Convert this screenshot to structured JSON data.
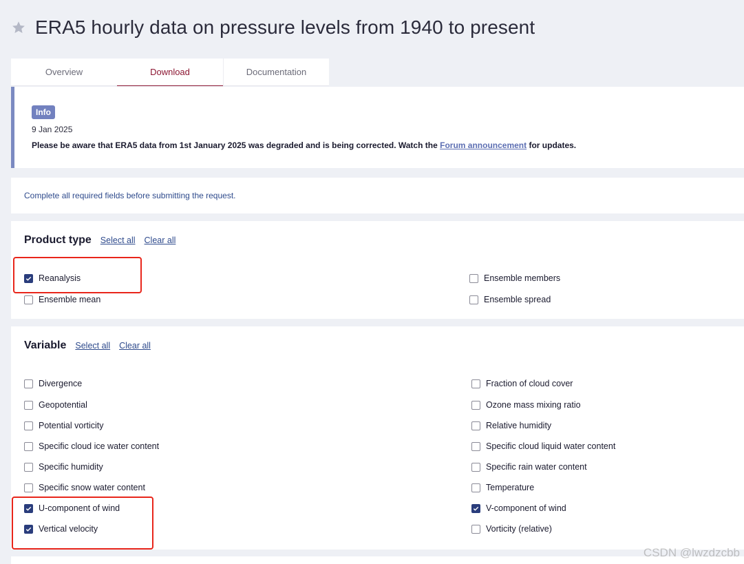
{
  "page": {
    "title": "ERA5 hourly data on pressure levels from 1940 to present",
    "tabs": [
      {
        "label": "Overview",
        "active": false
      },
      {
        "label": "Download",
        "active": true
      },
      {
        "label": "Documentation",
        "active": false
      }
    ]
  },
  "info": {
    "badge": "Info",
    "date": "9 Jan 2025",
    "message": "Please be aware that ERA5 data from 1st January 2025 was degraded and is being corrected. Watch the ",
    "link": "Forum announcement",
    "message_suffix": " for updates."
  },
  "notice": "Complete all required fields before submitting the request.",
  "product_type": {
    "title": "Product type",
    "select_all": "Select all",
    "clear_all": "Clear all",
    "options": [
      {
        "label": "Reanalysis",
        "checked": true
      },
      {
        "label": "Ensemble members",
        "checked": false
      },
      {
        "label": "Ensemble mean",
        "checked": false
      },
      {
        "label": "Ensemble spread",
        "checked": false
      }
    ]
  },
  "variable": {
    "title": "Variable",
    "select_all": "Select all",
    "clear_all": "Clear all",
    "options": [
      {
        "label": "Divergence",
        "checked": false
      },
      {
        "label": "Fraction of cloud cover",
        "checked": false
      },
      {
        "label": "Geopotential",
        "checked": false
      },
      {
        "label": "Ozone mass mixing ratio",
        "checked": false
      },
      {
        "label": "Potential vorticity",
        "checked": false
      },
      {
        "label": "Relative humidity",
        "checked": false
      },
      {
        "label": "Specific cloud ice water content",
        "checked": false
      },
      {
        "label": "Specific cloud liquid water content",
        "checked": false
      },
      {
        "label": "Specific humidity",
        "checked": false
      },
      {
        "label": "Specific rain water content",
        "checked": false
      },
      {
        "label": "Specific snow water content",
        "checked": false
      },
      {
        "label": "Temperature",
        "checked": false
      },
      {
        "label": "U-component of wind",
        "checked": true
      },
      {
        "label": "V-component of wind",
        "checked": true
      },
      {
        "label": "Vertical velocity",
        "checked": true
      },
      {
        "label": "Vorticity (relative)",
        "checked": false
      }
    ]
  },
  "watermark": "CSDN @lwzdzcbb",
  "colors": {
    "accent": "#8c1632",
    "checkbox": "#2a3d7c",
    "link": "#2e4a8c",
    "highlight": "#e8251a"
  }
}
